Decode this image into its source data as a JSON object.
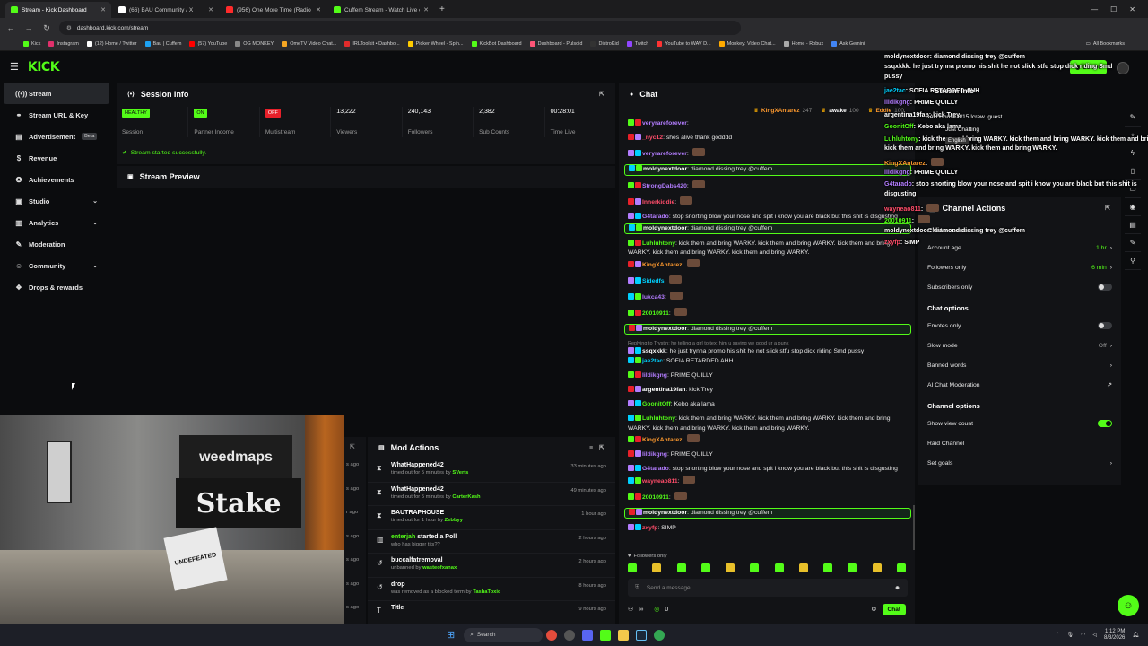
{
  "browser": {
    "tabs": [
      {
        "title": "Stream - Kick Dashboard",
        "color": "#53fc18"
      },
      {
        "title": "(66) BAU Community / X",
        "color": "#ffffff"
      },
      {
        "title": "(956) One More Time (Radio Ed",
        "color": "#ff2b2b"
      },
      {
        "title": "Cuffem Stream - Watch Live on",
        "color": "#53fc18"
      }
    ],
    "url": "dashboard.kick.com/stream",
    "bookmarks": [
      "Kick",
      "Instagram",
      "(12) Home / Twitter",
      "Bau | Cuffem",
      "(57) YouTube",
      "OG MONKEY",
      "OmeTV Video Chat...",
      "IRLToolkit • Dashbo...",
      "Picker Wheel - Spin...",
      "KickBot Dashboard",
      "Dashboard - Pulsoid",
      "DistroKid",
      "Twitch",
      "YouTube to WAV D...",
      "Monkey: Video Chat...",
      "Home - Robux",
      "Ask Gemini"
    ],
    "all_bookmarks": "All Bookmarks"
  },
  "kick": {
    "logo": "KICK",
    "go_live": "Go live",
    "sidebar": [
      {
        "label": "Stream",
        "icon": "stream-icon",
        "glyph": "((•))"
      },
      {
        "label": "Stream URL & Key",
        "icon": "link-icon",
        "glyph": "⚭"
      },
      {
        "label": "Advertisement",
        "icon": "ad-icon",
        "glyph": "▤",
        "badge": "Beta"
      },
      {
        "label": "Revenue",
        "icon": "revenue-icon",
        "glyph": "$"
      },
      {
        "label": "Achievements",
        "icon": "trophy-icon",
        "glyph": "✪"
      },
      {
        "label": "Studio",
        "icon": "studio-icon",
        "glyph": "▣",
        "expandable": true
      },
      {
        "label": "Analytics",
        "icon": "analytics-icon",
        "glyph": "▥",
        "expandable": true
      },
      {
        "label": "Moderation",
        "icon": "wrench-icon",
        "glyph": "✎"
      },
      {
        "label": "Community",
        "icon": "community-icon",
        "glyph": "☺",
        "expandable": true
      },
      {
        "label": "Drops & rewards",
        "icon": "gift-icon",
        "glyph": "❖"
      }
    ],
    "session": {
      "title": "Session Info",
      "stats": [
        {
          "value": "HEALTHY",
          "label": "Session",
          "pill": true,
          "bg": "#53fc18",
          "fg": "#0b0c0e"
        },
        {
          "value": "ON",
          "label": "Partner Income",
          "pill": true,
          "bg": "#53fc18",
          "fg": "#0b0c0e"
        },
        {
          "value": "OFF",
          "label": "Multistream",
          "pill": true,
          "bg": "#e8202a",
          "fg": "#ffffff"
        },
        {
          "value": "13,222",
          "label": "Viewers"
        },
        {
          "value": "240,143",
          "label": "Followers"
        },
        {
          "value": "2,382",
          "label": "Sub Counts"
        },
        {
          "value": "00:28:01",
          "label": "Time Live"
        }
      ],
      "status": "Stream started successfully."
    },
    "preview_title": "Stream Preview",
    "chat": {
      "title": "Chat",
      "pinned": [
        {
          "name": "KingXAntarez",
          "count": "247"
        },
        {
          "name": "awake",
          "count": "100"
        },
        {
          "name": "Eddie",
          "count": "100"
        }
      ],
      "messages": [
        {
          "user": "veryrareforever",
          "color": "#b37dff",
          "text": ""
        },
        {
          "user": "_nyc12",
          "color": "#ff4d6a",
          "text": "shes alive thank godddd"
        },
        {
          "user": "veryrareforever",
          "color": "#b37dff",
          "text": "",
          "emote": true
        },
        {
          "user": "moldynextdoor",
          "color": "#ffffff",
          "text": "diamond dissing trey @cuffem",
          "highlight": true
        },
        {
          "user": "StrongDabs420",
          "color": "#b37dff",
          "text": "",
          "emote": true
        },
        {
          "user": "Innerkiddie",
          "color": "#ff4d6a",
          "text": "",
          "emote": true
        },
        {
          "user": "G4tarado",
          "color": "#b37dff",
          "text": "stop snorting blow your nose and spit i know you are black but this shit is disgusting"
        },
        {
          "user": "moldynextdoor",
          "color": "#ffffff",
          "text": "diamond dissing trey @cuffem",
          "highlight": true
        },
        {
          "user": "Luhluhtony",
          "color": "#53fc18",
          "text": "kick them and bring WARKY. kick them and bring WARKY. kick them and bring WARKY. kick them and bring WARKY. kick them and bring WARKY."
        },
        {
          "user": "KingXAntarez",
          "color": "#ff9a2e",
          "text": "",
          "emote": true
        },
        {
          "user": "Sidedfs",
          "color": "#00d1ff",
          "text": "",
          "emote": true
        },
        {
          "user": "lukca43",
          "color": "#b37dff",
          "text": "",
          "emote": true
        },
        {
          "user": "20010911",
          "color": "#53fc18",
          "text": "",
          "emote": true
        },
        {
          "user": "moldynextdoor",
          "color": "#ffffff",
          "text": "diamond dissing trey @cuffem",
          "highlight": true
        },
        {
          "user": "ssqxkkk",
          "color": "#ffffff",
          "text": "he just trynna promo his shit he not slick stfu stop dick riding Smd pussy",
          "reply": "Replying to Trvstin: he telling a girl to text him u saying we good ur a punk"
        },
        {
          "user": "jae2tac",
          "color": "#00d1ff",
          "text": "SOFIA RETARDED AHH"
        },
        {
          "user": "lildikgng",
          "color": "#b37dff",
          "text": "PRIME QUILLY"
        },
        {
          "user": "argentina19fan",
          "color": "#ffffff",
          "text": "kick Trey"
        },
        {
          "user": "GoonitOff",
          "color": "#53fc18",
          "text": "Kebo aka lama"
        },
        {
          "user": "Luhluhtony",
          "color": "#53fc18",
          "text": "kick them and bring WARKY. kick them and bring WARKY. kick them and bring WARKY. kick them and bring WARKY. kick them and bring WARKY."
        },
        {
          "user": "KingXAntarez",
          "color": "#ff9a2e",
          "text": "",
          "emote": true
        },
        {
          "user": "lildikgng",
          "color": "#b37dff",
          "text": "PRIME QUILLY"
        },
        {
          "user": "G4tarado",
          "color": "#b37dff",
          "text": "stop snorting blow your nose and spit i know you are black but this shit is disgusting"
        },
        {
          "user": "wayneao811",
          "color": "#ff4d6a",
          "text": "",
          "emote": true
        },
        {
          "user": "20010911",
          "color": "#53fc18",
          "text": "",
          "emote": true
        },
        {
          "user": "moldynextdoor",
          "color": "#ffffff",
          "text": "diamond dissing trey @cuffem",
          "highlight": true
        },
        {
          "user": "zxyfp",
          "color": "#ff4d6a",
          "text": "SIMP"
        }
      ],
      "mode": "Followers only",
      "placeholder": "Send a message",
      "infinity": "∞",
      "points": "0",
      "send_label": "Chat"
    },
    "channel_actions": {
      "title": "Channel Actions",
      "chat_access_title": "Chat access",
      "account_age": {
        "label": "Account age",
        "value": "1 hr"
      },
      "followers_only": {
        "label": "Followers only",
        "value": "6 min"
      },
      "subscribers_only": {
        "label": "Subscribers only",
        "on": false
      },
      "chat_options_title": "Chat options",
      "emotes_only": {
        "label": "Emotes only",
        "on": false
      },
      "slow_mode": {
        "label": "Slow mode",
        "value": "Off"
      },
      "banned_words": "Banned words",
      "ai_moderation": "AI Chat Moderation",
      "channel_options_title": "Channel options",
      "show_view_count": {
        "label": "Show view count",
        "on": true
      },
      "raid_channel": "Raid Channel",
      "set_goals": "Set goals"
    },
    "mod_actions": {
      "title": "Mod Actions",
      "rows": [
        {
          "icon": "hourglass-icon",
          "glyph": "⧗",
          "title": "WhatHappened42",
          "desc": "timed out for 5 minutes by",
          "by": "SVerts",
          "time": "33 minutes ago"
        },
        {
          "icon": "hourglass-icon",
          "glyph": "⧗",
          "title": "WhatHappened42",
          "desc": "timed out for 5 minutes by",
          "by": "CarterKash",
          "time": "49 minutes ago"
        },
        {
          "icon": "hourglass-icon",
          "glyph": "⧗",
          "title": "BAUTRAPHOUSE",
          "desc": "timed out for 1 hour by",
          "by": "Zebbyy",
          "time": "1 hour ago"
        },
        {
          "icon": "poll-icon",
          "glyph": "▥",
          "title_user": "enterjah",
          "title": "started a Poll",
          "desc": "who has bigger tits??",
          "by": "",
          "time": "2 hours ago"
        },
        {
          "icon": "undo-icon",
          "glyph": "↺",
          "title": "buccalfatremoval",
          "desc": "unbanned by",
          "by": "wasteofxanax",
          "time": "2 hours ago"
        },
        {
          "icon": "undo-icon",
          "glyph": "↺",
          "title": "drop",
          "desc": "was removed as a blocked term by",
          "by": "TashaToxic",
          "time": "8 hours ago"
        },
        {
          "icon": "title-icon",
          "glyph": "T",
          "title": "Title",
          "desc": "",
          "by": "",
          "time": "9 hours ago"
        }
      ],
      "partial_times": [
        "s ago",
        "s ago",
        "r ago",
        "s ago",
        "s ago",
        "s ago",
        "s ago"
      ]
    },
    "overlay": {
      "lines": [
        {
          "user": "moldynextdoor",
          "color": "#ffffff",
          "text": "diamond dissing trey @cuffem"
        },
        {
          "user": "ssqxkkk",
          "color": "#ffffff",
          "text": "he just trynna promo his shit he not slick stfu stop dick riding Smd"
        },
        {
          "user": "",
          "color": "#ffffff",
          "text": "pussy"
        },
        {
          "user": "jae2tac",
          "color": "#00d1ff",
          "text": "SOFIA RETARDED AHH"
        },
        {
          "user": "lildikgng",
          "color": "#b37dff",
          "text": "PRIME QUILLY"
        },
        {
          "user": "argentina19fan",
          "color": "#ffffff",
          "text": "kick Trey"
        },
        {
          "user": "GoonitOff",
          "color": "#53fc18",
          "text": "Kebo aka lama"
        },
        {
          "user": "Luhluhtony",
          "color": "#53fc18",
          "text": "kick them and bring WARKY. kick them and bring WARKY. kick them and bring WARKY."
        },
        {
          "user": "",
          "color": "#ffffff",
          "text": "kick them and bring WARKY. kick them and bring WARKY."
        },
        {
          "user": "KingXAntarez",
          "color": "#ff9a2e",
          "text": ""
        },
        {
          "user": "lildikgng",
          "color": "#b37dff",
          "text": "PRIME QUILLY"
        },
        {
          "user": "G4tarado",
          "color": "#b37dff",
          "text": "stop snorting blow your nose and spit i know you are black but this shit is"
        },
        {
          "user": "",
          "color": "#ffffff",
          "text": "disgusting"
        },
        {
          "user": "wayneao811",
          "color": "#ff4d6a",
          "text": ""
        },
        {
          "user": "20010911",
          "color": "#53fc18",
          "text": ""
        },
        {
          "user": "moldynextdoor",
          "color": "#ffffff",
          "text": "diamond dissing trey @cuffem"
        },
        {
          "user": "zxyfp",
          "color": "#ff4d6a",
          "text": "SIMP"
        }
      ],
      "stream_info": "Stream Info",
      "house": "BAU House 8/15 !crew !guest",
      "category": "Just Chatting",
      "language": "English"
    },
    "webcam_sign_1": "weedmaps",
    "webcam_sign_2": "Stake",
    "webcam_bag": "UNDEFEATED"
  },
  "taskbar": {
    "search": "Search",
    "time": "1:12 PM",
    "date": "8/3/2026"
  }
}
